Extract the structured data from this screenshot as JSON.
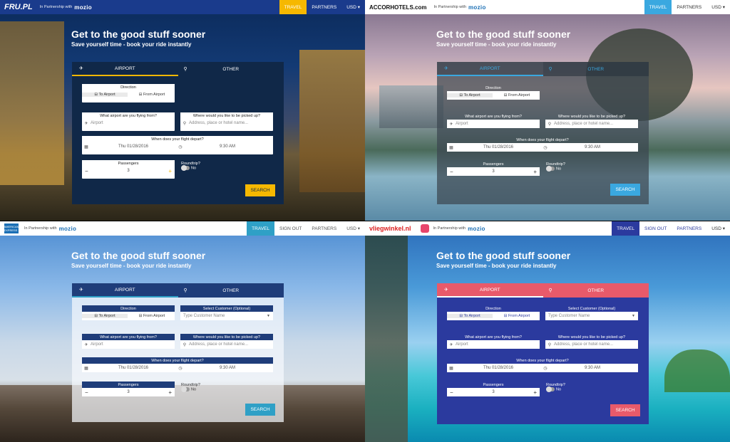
{
  "common": {
    "hero_title": "Get to the good stuff sooner",
    "hero_subtitle": "Save yourself time - book your ride instantly",
    "tab_airport": "AIRPORT",
    "tab_other": "OTHER",
    "direction_label": "Direction",
    "to_airport": "To Airport",
    "from_airport": "From Airport",
    "airport_question": "What airport are you flying from?",
    "airport_placeholder": "Airport",
    "pickup_question": "Where would you like to be picked up?",
    "pickup_placeholder": "Address, place or hotel name...",
    "depart_question": "When does your flight depart?",
    "date_value": "Thu 01/28/2016",
    "time_value": "9:30 AM",
    "passengers_label": "Passengers",
    "passengers_value": "3",
    "minus": "−",
    "plus": "+",
    "roundtrip_label": "Roundtrip?",
    "roundtrip_value": "No",
    "search_label": "SEARCH",
    "partnership": "In Partnership with",
    "mozio": "mozio",
    "select_customer_label": "Select Customer (Optional)",
    "select_customer_placeholder": "Type Customer Name"
  },
  "fru": {
    "logo": "FRU.PL",
    "nav": [
      "TRAVEL",
      "PARTNERS",
      "USD ▾"
    ]
  },
  "accor": {
    "logo": "ACCORHOTELS.com",
    "nav": [
      "TRAVEL",
      "PARTNERS",
      "USD ▾"
    ]
  },
  "amex": {
    "logo": "AMERICAN EXPRESS",
    "nav": [
      "TRAVEL",
      "SIGN OUT",
      "PARTNERS",
      "USD ▾"
    ]
  },
  "vlieg": {
    "logo": "vliegwinkel.nl",
    "nav": [
      "TRAVEL",
      "SIGN OUT",
      "PARTNERS",
      "USD ▾"
    ]
  },
  "colors": {
    "fru_accent": "#f6b800",
    "accor_accent": "#3aa8e0",
    "amex_accent": "#2fa0c6",
    "vlieg_accent": "#e85a6a",
    "vlieg_panel": "#2b3a9e"
  }
}
